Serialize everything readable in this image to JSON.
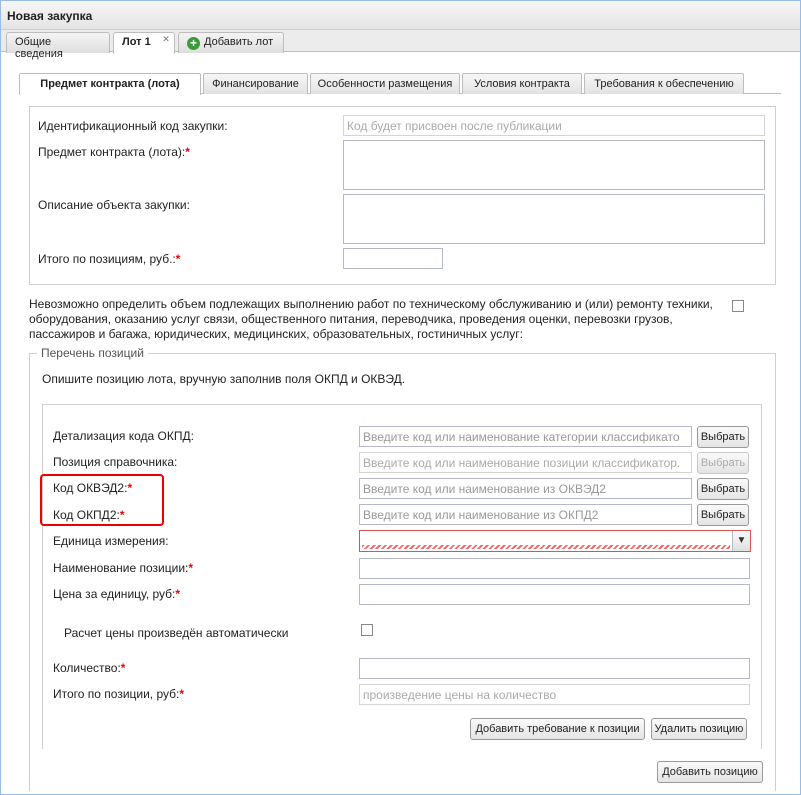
{
  "window": {
    "title": "Новая закупка"
  },
  "top_tabs": [
    {
      "label": "Общие сведения"
    },
    {
      "label": "Лот 1"
    },
    {
      "label": "Добавить лот"
    }
  ],
  "sub_tabs": [
    {
      "label": "Предмет контракта (лота)"
    },
    {
      "label": "Финансирование"
    },
    {
      "label": "Особенности размещения"
    },
    {
      "label": "Условия контракта"
    },
    {
      "label": "Требования к обеспечению"
    }
  ],
  "contract": {
    "id_code_label": "Идентификационный код закупки:",
    "id_code_placeholder": "Код будет присвоен после публикации",
    "subject_label": "Предмет контракта (лота):",
    "description_label": "Описание объекта закупки:",
    "total_label": "Итого по позициям, руб.:",
    "required_mark": "*"
  },
  "notice": {
    "text": "Невозможно определить объем подлежащих выполнению работ по техническому обслуживанию и (или) ремонту техники, оборудования, оказанию услуг связи, общественного питания, переводчика, проведения оценки, перевозки грузов, пассажиров и багажа, юридических, медицинских, образовательных, гостиничных услуг:"
  },
  "positions": {
    "legend": "Перечень позиций",
    "instruction": "Опишите позицию лота, вручную заполнив поля ОКПД и ОКВЭД.",
    "okpd_detail_label": "Детализация кода ОКПД:",
    "okpd_detail_placeholder": "Введите код или наименование категории классификато",
    "reference_label": "Позиция справочника:",
    "reference_placeholder": "Введите код или наименование позиции классификатор.",
    "okved2_label": "Код ОКВЭД2:",
    "okved2_placeholder": "Введите код или наименование из ОКВЭД2",
    "okpd2_label": "Код ОКПД2:",
    "okpd2_placeholder": "Введите код или наименование из ОКПД2",
    "unit_label": "Единица измерения:",
    "name_label": "Наименование позиции:",
    "price_label": "Цена за единицу, руб:",
    "auto_price_label": "Расчет цены произведён автоматически",
    "qty_label": "Количество:",
    "pos_total_label": "Итого по позиции, руб:",
    "pos_total_placeholder": "произведение цены на количество",
    "choose_label": "Выбрать",
    "add_requirement_label": "Добавить требование к позиции",
    "delete_position_label": "Удалить позицию",
    "add_position_label": "Добавить позицию"
  },
  "icons": {
    "add_lot": "plus-circle-icon",
    "close_tab": "close-icon",
    "dropdown": "chevron-down-icon"
  },
  "colors": {
    "required": "#e00000",
    "highlight": "#e00000",
    "add_icon": "#3c9a3c"
  }
}
